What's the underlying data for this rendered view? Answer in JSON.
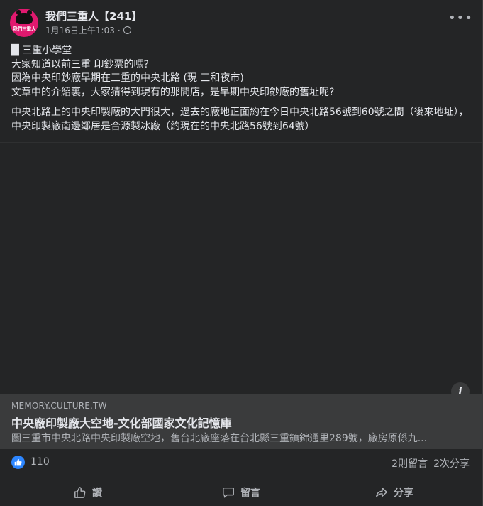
{
  "post": {
    "page_name": "我們三重人【241】",
    "avatar_text": "我們三重人",
    "timestamp": "1月16日上午1:03",
    "separator": "·",
    "more_label": "•••",
    "lines": [
      "█ 三重小學堂",
      "大家知道以前三重 印鈔票的嗎?",
      "因為中央印鈔廠早期在三重的中央北路 (現 三和夜市)",
      "文章中的介紹裏，大家猜得到現有的那間店，是早期中央印鈔廠的舊址呢?"
    ],
    "paragraph2": "中央北路上的中央印製廠的大門很大，過去的廠地正面約在今日中央北路56號到60號之間（後來地址），中央印製廠南邊鄰居是合源製冰廠（約現在的中央北路56號到64號）"
  },
  "link_preview": {
    "info_label": "i",
    "domain": "MEMORY.CULTURE.TW",
    "title": "中央廠印製廠大空地-文化部國家文化記憶庫",
    "description": "圖三重市中央北路中央印製廠空地，舊台北廠座落在台北縣三重鎮錦通里289號，廠房原係九..."
  },
  "stats": {
    "like_count": "110",
    "comments": "2則留言",
    "shares": "2次分享"
  },
  "actions": {
    "like": "讚",
    "comment": "留言",
    "share": "分享"
  },
  "colors": {
    "card_bg": "#242526",
    "link_bg": "#3a3b3c",
    "text_primary": "#e4e6eb",
    "text_secondary": "#b0b3b8",
    "like_blue": "#2d86ff",
    "avatar_pink": "#e0196f"
  }
}
